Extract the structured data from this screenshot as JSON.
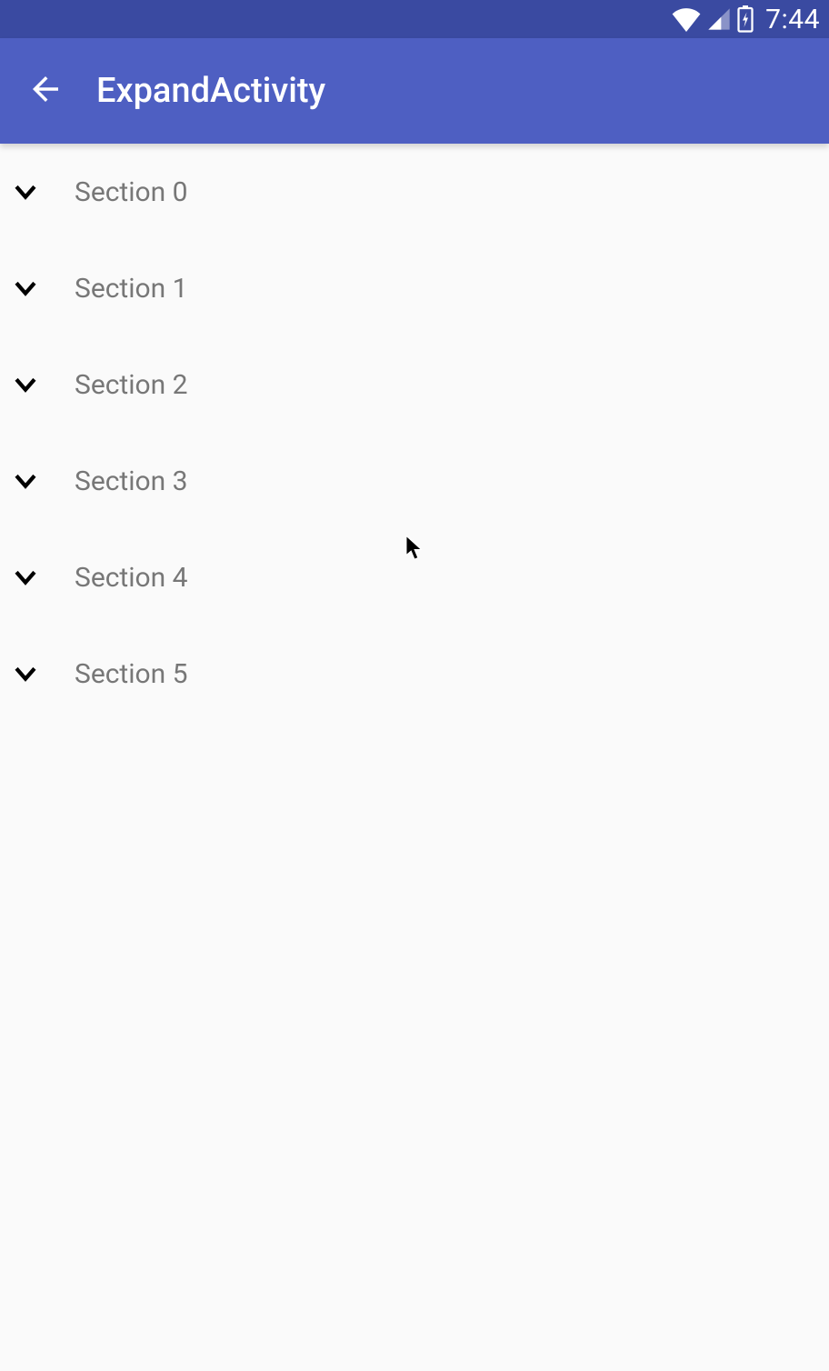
{
  "status_bar": {
    "time": "7:44"
  },
  "app_bar": {
    "title": "ExpandActivity"
  },
  "sections": [
    {
      "label": "Section 0"
    },
    {
      "label": "Section 1"
    },
    {
      "label": "Section 2"
    },
    {
      "label": "Section 3"
    },
    {
      "label": "Section 4"
    },
    {
      "label": "Section 5"
    }
  ]
}
